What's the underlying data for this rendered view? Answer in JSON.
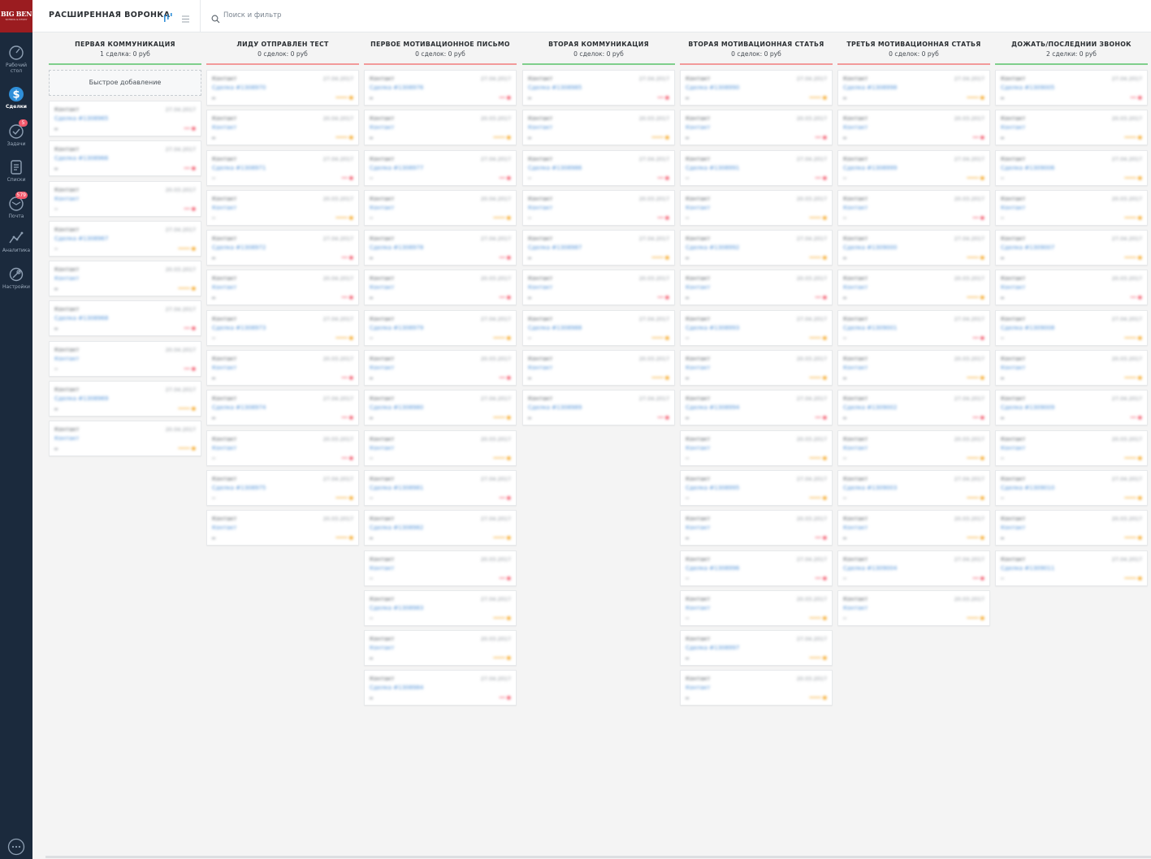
{
  "logo": {
    "line1": "BIG BEN",
    "line2": "SCHOOL & STUDY"
  },
  "sidebar": {
    "items": [
      {
        "label": "Рабочий стол",
        "icon": "dashboard-icon",
        "active": false
      },
      {
        "label": "Сделки",
        "icon": "deals-icon",
        "active": true
      },
      {
        "label": "Задачи",
        "icon": "tasks-icon",
        "badge": "5"
      },
      {
        "label": "Списки",
        "icon": "lists-icon"
      },
      {
        "label": "Почта",
        "icon": "mail-icon",
        "badge": "579"
      },
      {
        "label": "Аналитика",
        "icon": "analytics-icon"
      },
      {
        "label": "Настройки",
        "icon": "settings-icon"
      }
    ],
    "chat_icon": "chat-icon"
  },
  "topbar": {
    "pipeline_title": "РАСШИРЕННАЯ ВОРОНКА",
    "view_icon": "pipeline-view-icon",
    "list_icon": "list-view-icon",
    "search_placeholder": "Поиск и фильтр"
  },
  "colors": {
    "sidebar_bg": "#1b2a3d",
    "logo_bg": "#9b1c20",
    "link_blue": "#4c8fd6",
    "badge_red": "#f2586b",
    "status_red": "#f2586b",
    "status_orange": "#f5a623"
  },
  "quick_add_label": "Быстрое добавление",
  "columns": [
    {
      "title": "ПЕРВАЯ КОММУНИКАЦИЯ",
      "summary": "1 сделка: 0 руб",
      "line_color": "#7fce8b",
      "quick_add": true,
      "cards": [
        {
          "name": "Контакт",
          "date": "27.04.2017",
          "deal": "Сделка #1308965",
          "status": "red"
        },
        {
          "name": "Контакт",
          "date": "27.04.2017",
          "deal": "Сделка #1308966",
          "status": "red"
        },
        {
          "name": "Контакт",
          "date": "20.03.2017",
          "deal": "Контакт",
          "status": "red"
        },
        {
          "name": "Контакт",
          "date": "27.04.2017",
          "deal": "Сделка #1308967",
          "status": "orange"
        },
        {
          "name": "Контакт",
          "date": "20.03.2017",
          "deal": "Контакт",
          "status": "orange"
        },
        {
          "name": "Контакт",
          "date": "27.04.2017",
          "deal": "Сделка #1308968",
          "status": "red"
        },
        {
          "name": "Контакт",
          "date": "20.04.2017",
          "deal": "Контакт",
          "status": "red"
        },
        {
          "name": "Контакт",
          "date": "27.04.2017",
          "deal": "Сделка #1308969",
          "status": "orange"
        },
        {
          "name": "Контакт",
          "date": "20.04.2017",
          "deal": "Контакт",
          "status": "orange"
        }
      ]
    },
    {
      "title": "ЛИДУ ОТПРАВЛЕН ТЕСТ",
      "summary": "0 сделок: 0 руб",
      "line_color": "#f29a9a",
      "cards": [
        {
          "name": "Контакт",
          "date": "27.04.2017",
          "deal": "Сделка #1308970",
          "status": "orange"
        },
        {
          "name": "Контакт",
          "date": "20.04.2017",
          "deal": "Контакт",
          "status": "orange"
        },
        {
          "name": "Контакт",
          "date": "27.04.2017",
          "deal": "Сделка #1308971",
          "status": "red"
        },
        {
          "name": "Контакт",
          "date": "20.03.2017",
          "deal": "Контакт",
          "status": "orange"
        },
        {
          "name": "Контакт",
          "date": "27.04.2017",
          "deal": "Сделка #1308972",
          "status": "red"
        },
        {
          "name": "Контакт",
          "date": "20.04.2017",
          "deal": "Контакт",
          "status": "red"
        },
        {
          "name": "Контакт",
          "date": "27.04.2017",
          "deal": "Сделка #1308973",
          "status": "orange"
        },
        {
          "name": "Контакт",
          "date": "20.03.2017",
          "deal": "Контакт",
          "status": "red"
        },
        {
          "name": "Контакт",
          "date": "27.04.2017",
          "deal": "Сделка #1308974",
          "status": "red"
        },
        {
          "name": "Контакт",
          "date": "20.03.2017",
          "deal": "Контакт",
          "status": "red"
        },
        {
          "name": "Контакт",
          "date": "27.04.2017",
          "deal": "Сделка #1308975",
          "status": "orange"
        },
        {
          "name": "Контакт",
          "date": "20.03.2017",
          "deal": "Контакт",
          "status": "orange"
        }
      ]
    },
    {
      "title": "ПЕРВОЕ МОТИВАЦИОННОЕ ПИСЬМО",
      "summary": "0 сделок: 0 руб",
      "line_color": "#f29a9a",
      "cards": [
        {
          "name": "Контакт",
          "date": "27.04.2017",
          "deal": "Сделка #1308976",
          "status": "red"
        },
        {
          "name": "Контакт",
          "date": "20.03.2017",
          "deal": "Контакт",
          "status": "orange"
        },
        {
          "name": "Контакт",
          "date": "27.04.2017",
          "deal": "Сделка #1308977",
          "status": "red"
        },
        {
          "name": "Контакт",
          "date": "20.04.2017",
          "deal": "Контакт",
          "status": "orange"
        },
        {
          "name": "Контакт",
          "date": "27.04.2017",
          "deal": "Сделка #1308978",
          "status": "red"
        },
        {
          "name": "Контакт",
          "date": "20.03.2017",
          "deal": "Контакт",
          "status": "red"
        },
        {
          "name": "Контакт",
          "date": "27.04.2017",
          "deal": "Сделка #1308979",
          "status": "orange"
        },
        {
          "name": "Контакт",
          "date": "20.03.2017",
          "deal": "Контакт",
          "status": "red"
        },
        {
          "name": "Контакт",
          "date": "27.04.2017",
          "deal": "Сделка #1308980",
          "status": "orange"
        },
        {
          "name": "Контакт",
          "date": "20.03.2017",
          "deal": "Контакт",
          "status": "orange"
        },
        {
          "name": "Контакт",
          "date": "27.04.2017",
          "deal": "Сделка #1308981",
          "status": "red"
        },
        {
          "name": "Контакт",
          "date": "27.04.2017",
          "deal": "Сделка #1308982",
          "status": "orange"
        },
        {
          "name": "Контакт",
          "date": "20.03.2017",
          "deal": "Контакт",
          "status": "red"
        },
        {
          "name": "Контакт",
          "date": "27.04.2017",
          "deal": "Сделка #1308983",
          "status": "orange"
        },
        {
          "name": "Контакт",
          "date": "20.03.2017",
          "deal": "Контакт",
          "status": "orange"
        },
        {
          "name": "Контакт",
          "date": "27.04.2017",
          "deal": "Сделка #1308984",
          "status": "red"
        }
      ]
    },
    {
      "title": "ВТОРАЯ КОММУНИКАЦИЯ",
      "summary": "0 сделок: 0 руб",
      "line_color": "#7fce8b",
      "cards": [
        {
          "name": "Контакт",
          "date": "27.04.2017",
          "deal": "Сделка #1308985",
          "status": "red"
        },
        {
          "name": "Контакт",
          "date": "20.03.2017",
          "deal": "Контакт",
          "status": "orange"
        },
        {
          "name": "Контакт",
          "date": "27.04.2017",
          "deal": "Сделка #1308986",
          "status": "red"
        },
        {
          "name": "Контакт",
          "date": "20.03.2017",
          "deal": "Контакт",
          "status": "red"
        },
        {
          "name": "Контакт",
          "date": "27.04.2017",
          "deal": "Сделка #1308987",
          "status": "orange"
        },
        {
          "name": "Контакт",
          "date": "20.03.2017",
          "deal": "Контакт",
          "status": "red"
        },
        {
          "name": "Контакт",
          "date": "27.04.2017",
          "deal": "Сделка #1308988",
          "status": "orange"
        },
        {
          "name": "Контакт",
          "date": "20.03.2017",
          "deal": "Контакт",
          "status": "orange"
        },
        {
          "name": "Контакт",
          "date": "27.04.2017",
          "deal": "Сделка #1308989",
          "status": "red"
        }
      ]
    },
    {
      "title": "ВТОРАЯ МОТИВАЦИОННАЯ СТАТЬЯ",
      "summary": "0 сделок: 0 руб",
      "line_color": "#f29a9a",
      "cards": [
        {
          "name": "Контакт",
          "date": "27.04.2017",
          "deal": "Сделка #1308990",
          "status": "orange"
        },
        {
          "name": "Контакт",
          "date": "20.03.2017",
          "deal": "Контакт",
          "status": "red"
        },
        {
          "name": "Контакт",
          "date": "27.04.2017",
          "deal": "Сделка #1308991",
          "status": "red"
        },
        {
          "name": "Контакт",
          "date": "20.03.2017",
          "deal": "Контакт",
          "status": "orange"
        },
        {
          "name": "Контакт",
          "date": "27.04.2017",
          "deal": "Сделка #1308992",
          "status": "orange"
        },
        {
          "name": "Контакт",
          "date": "20.03.2017",
          "deal": "Контакт",
          "status": "red"
        },
        {
          "name": "Контакт",
          "date": "27.04.2017",
          "deal": "Сделка #1308993",
          "status": "orange"
        },
        {
          "name": "Контакт",
          "date": "20.03.2017",
          "deal": "Контакт",
          "status": "orange"
        },
        {
          "name": "Контакт",
          "date": "27.04.2017",
          "deal": "Сделка #1308994",
          "status": "red"
        },
        {
          "name": "Контакт",
          "date": "20.03.2017",
          "deal": "Контакт",
          "status": "orange"
        },
        {
          "name": "Контакт",
          "date": "27.04.2017",
          "deal": "Сделка #1308995",
          "status": "orange"
        },
        {
          "name": "Контакт",
          "date": "20.03.2017",
          "deal": "Контакт",
          "status": "red"
        },
        {
          "name": "Контакт",
          "date": "27.04.2017",
          "deal": "Сделка #1308996",
          "status": "red"
        },
        {
          "name": "Контакт",
          "date": "20.03.2017",
          "deal": "Контакт",
          "status": "orange"
        },
        {
          "name": "Контакт",
          "date": "27.04.2017",
          "deal": "Сделка #1308997",
          "status": "orange"
        },
        {
          "name": "Контакт",
          "date": "20.03.2017",
          "deal": "Контакт",
          "status": "orange"
        }
      ]
    },
    {
      "title": "ТРЕТЬЯ МОТИВАЦИОННАЯ СТАТЬЯ",
      "summary": "0 сделок: 0 руб",
      "line_color": "#f29a9a",
      "cards": [
        {
          "name": "Контакт",
          "date": "27.04.2017",
          "deal": "Сделка #1308998",
          "status": "orange"
        },
        {
          "name": "Контакт",
          "date": "20.03.2017",
          "deal": "Контакт",
          "status": "red"
        },
        {
          "name": "Контакт",
          "date": "27.04.2017",
          "deal": "Сделка #1308999",
          "status": "orange"
        },
        {
          "name": "Контакт",
          "date": "20.03.2017",
          "deal": "Контакт",
          "status": "red"
        },
        {
          "name": "Контакт",
          "date": "27.04.2017",
          "deal": "Сделка #1309000",
          "status": "orange"
        },
        {
          "name": "Контакт",
          "date": "20.03.2017",
          "deal": "Контакт",
          "status": "orange"
        },
        {
          "name": "Контакт",
          "date": "27.04.2017",
          "deal": "Сделка #1309001",
          "status": "red"
        },
        {
          "name": "Контакт",
          "date": "20.03.2017",
          "deal": "Контакт",
          "status": "orange"
        },
        {
          "name": "Контакт",
          "date": "27.04.2017",
          "deal": "Сделка #1309002",
          "status": "red"
        },
        {
          "name": "Контакт",
          "date": "20.03.2017",
          "deal": "Контакт",
          "status": "orange"
        },
        {
          "name": "Контакт",
          "date": "27.04.2017",
          "deal": "Сделка #1309003",
          "status": "orange"
        },
        {
          "name": "Контакт",
          "date": "20.03.2017",
          "deal": "Контакт",
          "status": "orange"
        },
        {
          "name": "Контакт",
          "date": "27.04.2017",
          "deal": "Сделка #1309004",
          "status": "red"
        },
        {
          "name": "Контакт",
          "date": "20.03.2017",
          "deal": "Контакт",
          "status": "orange"
        }
      ]
    },
    {
      "title": "ДОЖАТЬ/ПОСЛЕДНИИ ЗВОНОК",
      "summary": "2 сделки: 0 руб",
      "line_color": "#7fce8b",
      "cards": [
        {
          "name": "Контакт",
          "date": "27.04.2017",
          "deal": "Сделка #1309005",
          "status": "red"
        },
        {
          "name": "Контакт",
          "date": "20.03.2017",
          "deal": "Контакт",
          "status": "orange"
        },
        {
          "name": "Контакт",
          "date": "27.04.2017",
          "deal": "Сделка #1309006",
          "status": "orange"
        },
        {
          "name": "Контакт",
          "date": "20.03.2017",
          "deal": "Контакт",
          "status": "orange"
        },
        {
          "name": "Контакт",
          "date": "27.04.2017",
          "deal": "Сделка #1309007",
          "status": "orange"
        },
        {
          "name": "Контакт",
          "date": "20.03.2017",
          "deal": "Контакт",
          "status": "red"
        },
        {
          "name": "Контакт",
          "date": "27.04.2017",
          "deal": "Сделка #1309008",
          "status": "orange"
        },
        {
          "name": "Контакт",
          "date": "20.03.2017",
          "deal": "Контакт",
          "status": "orange"
        },
        {
          "name": "Контакт",
          "date": "27.04.2017",
          "deal": "Сделка #1309009",
          "status": "red"
        },
        {
          "name": "Контакт",
          "date": "20.03.2017",
          "deal": "Контакт",
          "status": "orange"
        },
        {
          "name": "Контакт",
          "date": "27.04.2017",
          "deal": "Сделка #1309010",
          "status": "orange"
        },
        {
          "name": "Контакт",
          "date": "20.03.2017",
          "deal": "Контакт",
          "status": "orange"
        },
        {
          "name": "Контакт",
          "date": "27.04.2017",
          "deal": "Сделка #1309011",
          "status": "orange"
        }
      ]
    }
  ]
}
